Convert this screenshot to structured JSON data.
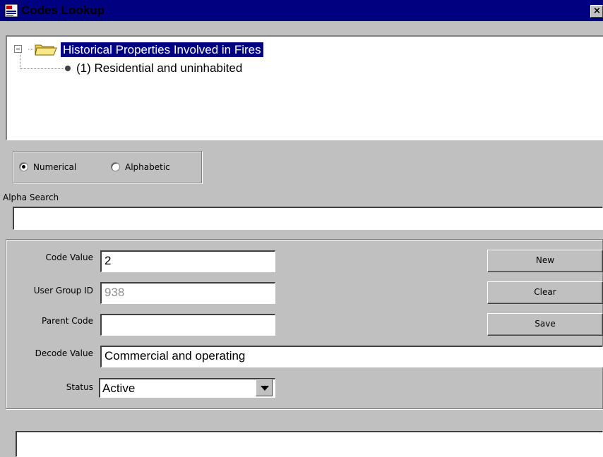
{
  "window": {
    "title": "Codes Lookup",
    "close_label": "×"
  },
  "tree": {
    "root_label": "Historical Properties Involved in Fires",
    "children": [
      {
        "label": "(1) Residential and uninhabited"
      }
    ]
  },
  "sort_options": {
    "numerical_label": "Numerical",
    "alphabetic_label": "Alphabetic",
    "selected": "Numerical"
  },
  "alpha_search": {
    "label": "Alpha Search",
    "value": ""
  },
  "form": {
    "code_value": {
      "label": "Code Value",
      "value": "2"
    },
    "user_group_id": {
      "label": "User Group ID",
      "value": "938"
    },
    "parent_code": {
      "label": "Parent Code",
      "value": ""
    },
    "decode_value": {
      "label": "Decode Value",
      "value": "Commercial and operating"
    },
    "status": {
      "label": "Status",
      "value": "Active"
    }
  },
  "buttons": {
    "new_label": "New",
    "clear_label": "Clear",
    "save_label": "Save"
  },
  "status_bar": {
    "text": ""
  },
  "colors": {
    "title_bar": "#000080",
    "selection": "#000080",
    "face": "#c0c0c0"
  }
}
